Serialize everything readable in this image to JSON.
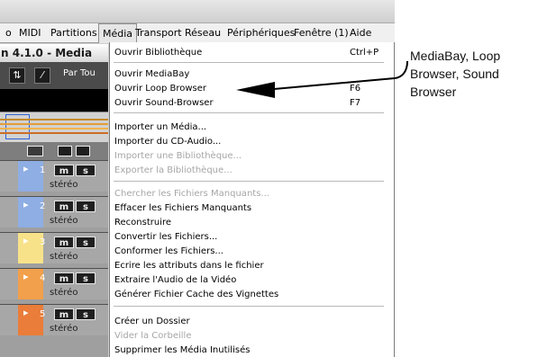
{
  "menubar": {
    "items": [
      {
        "label": "o"
      },
      {
        "label": "MIDI"
      },
      {
        "label": "Partitions"
      },
      {
        "label": "Média"
      },
      {
        "label": "Transport"
      },
      {
        "label": "Réseau"
      },
      {
        "label": "Périphériques"
      },
      {
        "label": "Fenêtre (1)"
      },
      {
        "label": "Aide"
      }
    ]
  },
  "project": {
    "title": "n 4.1.0 - Media"
  },
  "toolbar": {
    "part_label": "Par Tou"
  },
  "track_header": {
    "buttons": [
      "m",
      "s"
    ]
  },
  "tracks": [
    {
      "number": "1",
      "mute": "m",
      "solo": "s",
      "label": "stéréo",
      "color": "#8eaee4"
    },
    {
      "number": "2",
      "mute": "m",
      "solo": "s",
      "label": "stéréo",
      "color": "#8eaee4"
    },
    {
      "number": "3",
      "mute": "m",
      "solo": "s",
      "label": "stéréo",
      "color": "#f7e28a"
    },
    {
      "number": "4",
      "mute": "m",
      "solo": "s",
      "label": "stéréo",
      "color": "#f2a04b"
    },
    {
      "number": "5",
      "mute": "m",
      "solo": "s",
      "label": "stéréo",
      "color": "#ea7d39"
    }
  ],
  "media_menu": {
    "items": [
      {
        "label": "Ouvrir Bibliothèque",
        "shortcut": "Ctrl+P",
        "enabled": true
      },
      {
        "label": "Ouvrir MediaBay",
        "shortcut": "",
        "enabled": true
      },
      {
        "label": "Ouvrir Loop Browser",
        "shortcut": "F6",
        "enabled": true
      },
      {
        "label": "Ouvrir Sound-Browser",
        "shortcut": "F7",
        "enabled": true
      },
      {
        "label": "Importer un Média...",
        "shortcut": "",
        "enabled": true
      },
      {
        "label": "Importer du CD-Audio...",
        "shortcut": "",
        "enabled": true
      },
      {
        "label": "Importer une Bibliothèque...",
        "shortcut": "",
        "enabled": false
      },
      {
        "label": "Exporter la Bibliothèque...",
        "shortcut": "",
        "enabled": false
      },
      {
        "label": "Chercher les Fichiers Manquants...",
        "shortcut": "",
        "enabled": false
      },
      {
        "label": "Effacer les Fichiers Manquants",
        "shortcut": "",
        "enabled": true
      },
      {
        "label": "Reconstruire",
        "shortcut": "",
        "enabled": true
      },
      {
        "label": "Convertir les Fichiers...",
        "shortcut": "",
        "enabled": true
      },
      {
        "label": "Conformer les Fichiers...",
        "shortcut": "",
        "enabled": true
      },
      {
        "label": "Ecrire les attributs dans le fichier",
        "shortcut": "",
        "enabled": true
      },
      {
        "label": "Extraire l'Audio de la Vidéo",
        "shortcut": "",
        "enabled": true
      },
      {
        "label": "Générer Fichier Cache des Vignettes",
        "shortcut": "",
        "enabled": true
      },
      {
        "label": "Créer un Dossier",
        "shortcut": "",
        "enabled": true
      },
      {
        "label": "Vider la Corbeille",
        "shortcut": "",
        "enabled": false
      },
      {
        "label": "Supprimer les Média Inutilisés",
        "shortcut": "",
        "enabled": true
      }
    ]
  },
  "annotation": {
    "text": "MediaBay, Loop Browser, Sound Browser"
  },
  "colors": {
    "menu_disabled": "#a6a6a6",
    "overview_lines": [
      "#c58a2a",
      "#e29d38",
      "#f1b34e",
      "#cc6f24"
    ],
    "selection_box": "#2d63d8"
  }
}
